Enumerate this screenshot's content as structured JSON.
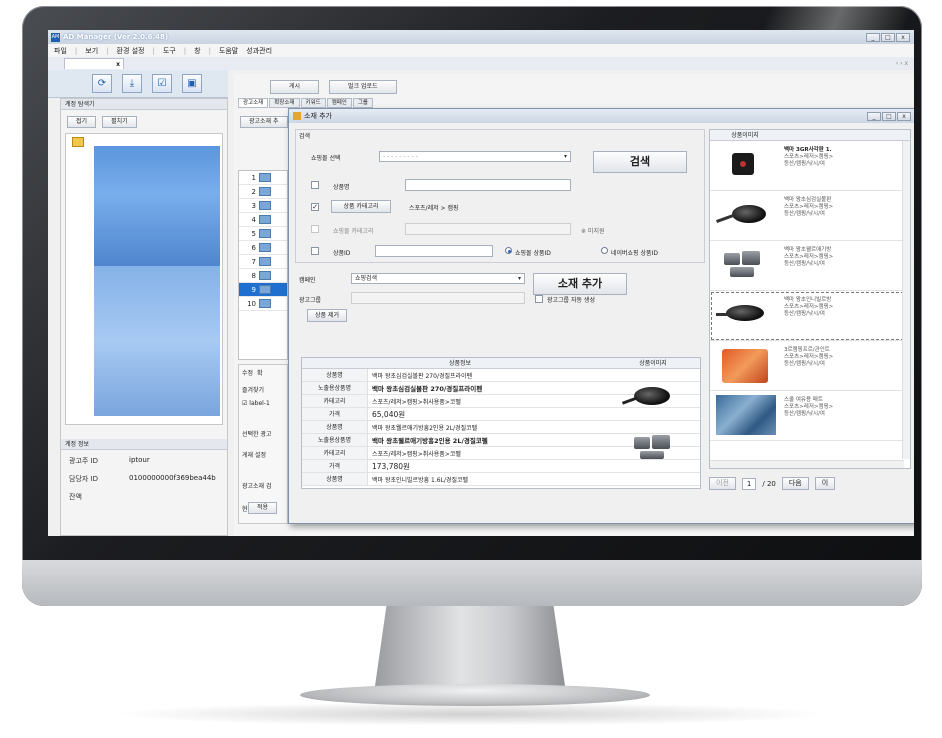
{
  "app": {
    "title": "AD Manager (Ver 2.0.6.48)",
    "icon_text": "AM",
    "window_buttons": [
      "_",
      "□",
      "x"
    ],
    "menu": [
      "파일",
      "보기",
      "환경 설정",
      "도구",
      "창",
      "도움말",
      "성과관리"
    ],
    "doc_tab_close": "x",
    "tab_nav": "‹ › x"
  },
  "toolbar": {
    "icons": [
      "refresh-icon",
      "download-icon",
      "check-icon",
      "save-icon"
    ],
    "glyphs": [
      "⟳",
      "⤓",
      "☑",
      "▣"
    ]
  },
  "left_panel": {
    "header": "계정 탐색기",
    "expand_label": "접기",
    "collapse_label": "펼치기",
    "account_header": "계정 정보",
    "advertiser_key": "광고주 ID",
    "advertiser_value": "iptour",
    "manager_key": "담당자 ID",
    "manager_value": "0100000000f369bea44b",
    "balance_key": "잔액"
  },
  "main": {
    "buttons": [
      "게시",
      "벌크 업로드"
    ],
    "sub_tabs": [
      "광고소재",
      "확장소재",
      "키워드",
      "캠페인",
      "그룹"
    ],
    "sub_label": "광고소재 추",
    "row_numbers": [
      "1",
      "2",
      "3",
      "4",
      "5",
      "6",
      "7",
      "8",
      "9",
      "10"
    ],
    "selected_row": "9",
    "lower_tabs": [
      "수정",
      "확"
    ],
    "favorites": "즐겨찾기",
    "label_item": "label-1",
    "selected_ad": "선택한 광고",
    "publish_setting": "게재 설정",
    "ad_review": "광고소재 검",
    "current": "현재",
    "apply": "적용"
  },
  "dialog": {
    "title": "소재 추가",
    "window_buttons": [
      "_",
      "□",
      "x"
    ],
    "search_group": "검색",
    "mall_label": "쇼핑몰 선택",
    "mall_value": "- - - - - - - - -",
    "search_button": "검색",
    "product_name_label": "상품명",
    "product_name_value": "",
    "category_button": "상품 카테고리",
    "category_value": "스포츠/레저 > 캠핑",
    "mall_category_label": "쇼핑몰 카테고리",
    "not_supported": "※ 미지원",
    "product_id_label": "상품ID",
    "product_id_value": "",
    "radio_mall_id": "쇼핑몰 상품ID",
    "radio_naver_id": "네이버쇼핑 상품ID",
    "campaign_label": "캠페인",
    "campaign_value": "쇼핑검색",
    "ad_group_label": "광고그룹",
    "auto_group_label": "광고그룹 자동 생성",
    "add_button": "소재 추가",
    "remove_button": "상품 제거",
    "table_headers": [
      "상품정보",
      "상품이미지"
    ],
    "products": [
      {
        "rows": [
          {
            "k": "상품명",
            "v": "백마 왕초심검실볼판 270/경질프라이펜"
          },
          {
            "k": "노출용상품명",
            "v": "백마 왕초심검실볼판 270/경질프라이펜"
          },
          {
            "k": "카테고리",
            "v": "스포츠/레저>캠핑>취사용품>코펠"
          },
          {
            "k": "가격",
            "v": "65,040원"
          }
        ]
      },
      {
        "rows": [
          {
            "k": "상품명",
            "v": "백마 왕초웰르애기방흥2인용 2L/경질코펠"
          },
          {
            "k": "노출용상품명",
            "v": "백마 왕초웰르애기방흥2인용 2L/경질코펠"
          },
          {
            "k": "카테고리",
            "v": "스포츠/레저>캠핑>취사용품>코펠"
          },
          {
            "k": "가격",
            "v": "173,780원"
          }
        ]
      },
      {
        "rows": [
          {
            "k": "상품명",
            "v": "백마 왕초인니빌르방흥 1.6L/경질코펠"
          }
        ]
      }
    ],
    "image_panel_header": "상품이미지",
    "image_items": [
      {
        "name": "백마 3GR사각판 1.",
        "cat": "스포츠>레저>캠핑>",
        "sub": "등산/캠핑/낚시/여"
      },
      {
        "name": "백마 왕초심검실볼판",
        "cat": "스포츠>레저>캠핑>",
        "sub": "등산/캠핑/낚시/여"
      },
      {
        "name": "백마 왕초웰르애기방",
        "cat": "스포츠>레저>캠핑>",
        "sub": "등산/캠핑/낚시/여"
      },
      {
        "name": "백마 왕초인니빌르방",
        "cat": "스포츠>레저>캠핑>",
        "sub": "등산/캠핑/낚시/여"
      },
      {
        "name": "3르캠핑프르/관인트",
        "cat": "스포츠>레저>캠핑>",
        "sub": "등산/캠핑/낚시/여"
      },
      {
        "name": "스쿨 여유용 매트",
        "cat": "스포츠>레저>캠핑>",
        "sub": "등산/캠핑/낚시/여"
      }
    ],
    "prev": "이전",
    "page": "1",
    "total": "/ 20",
    "next": "다음",
    "last": "이"
  }
}
